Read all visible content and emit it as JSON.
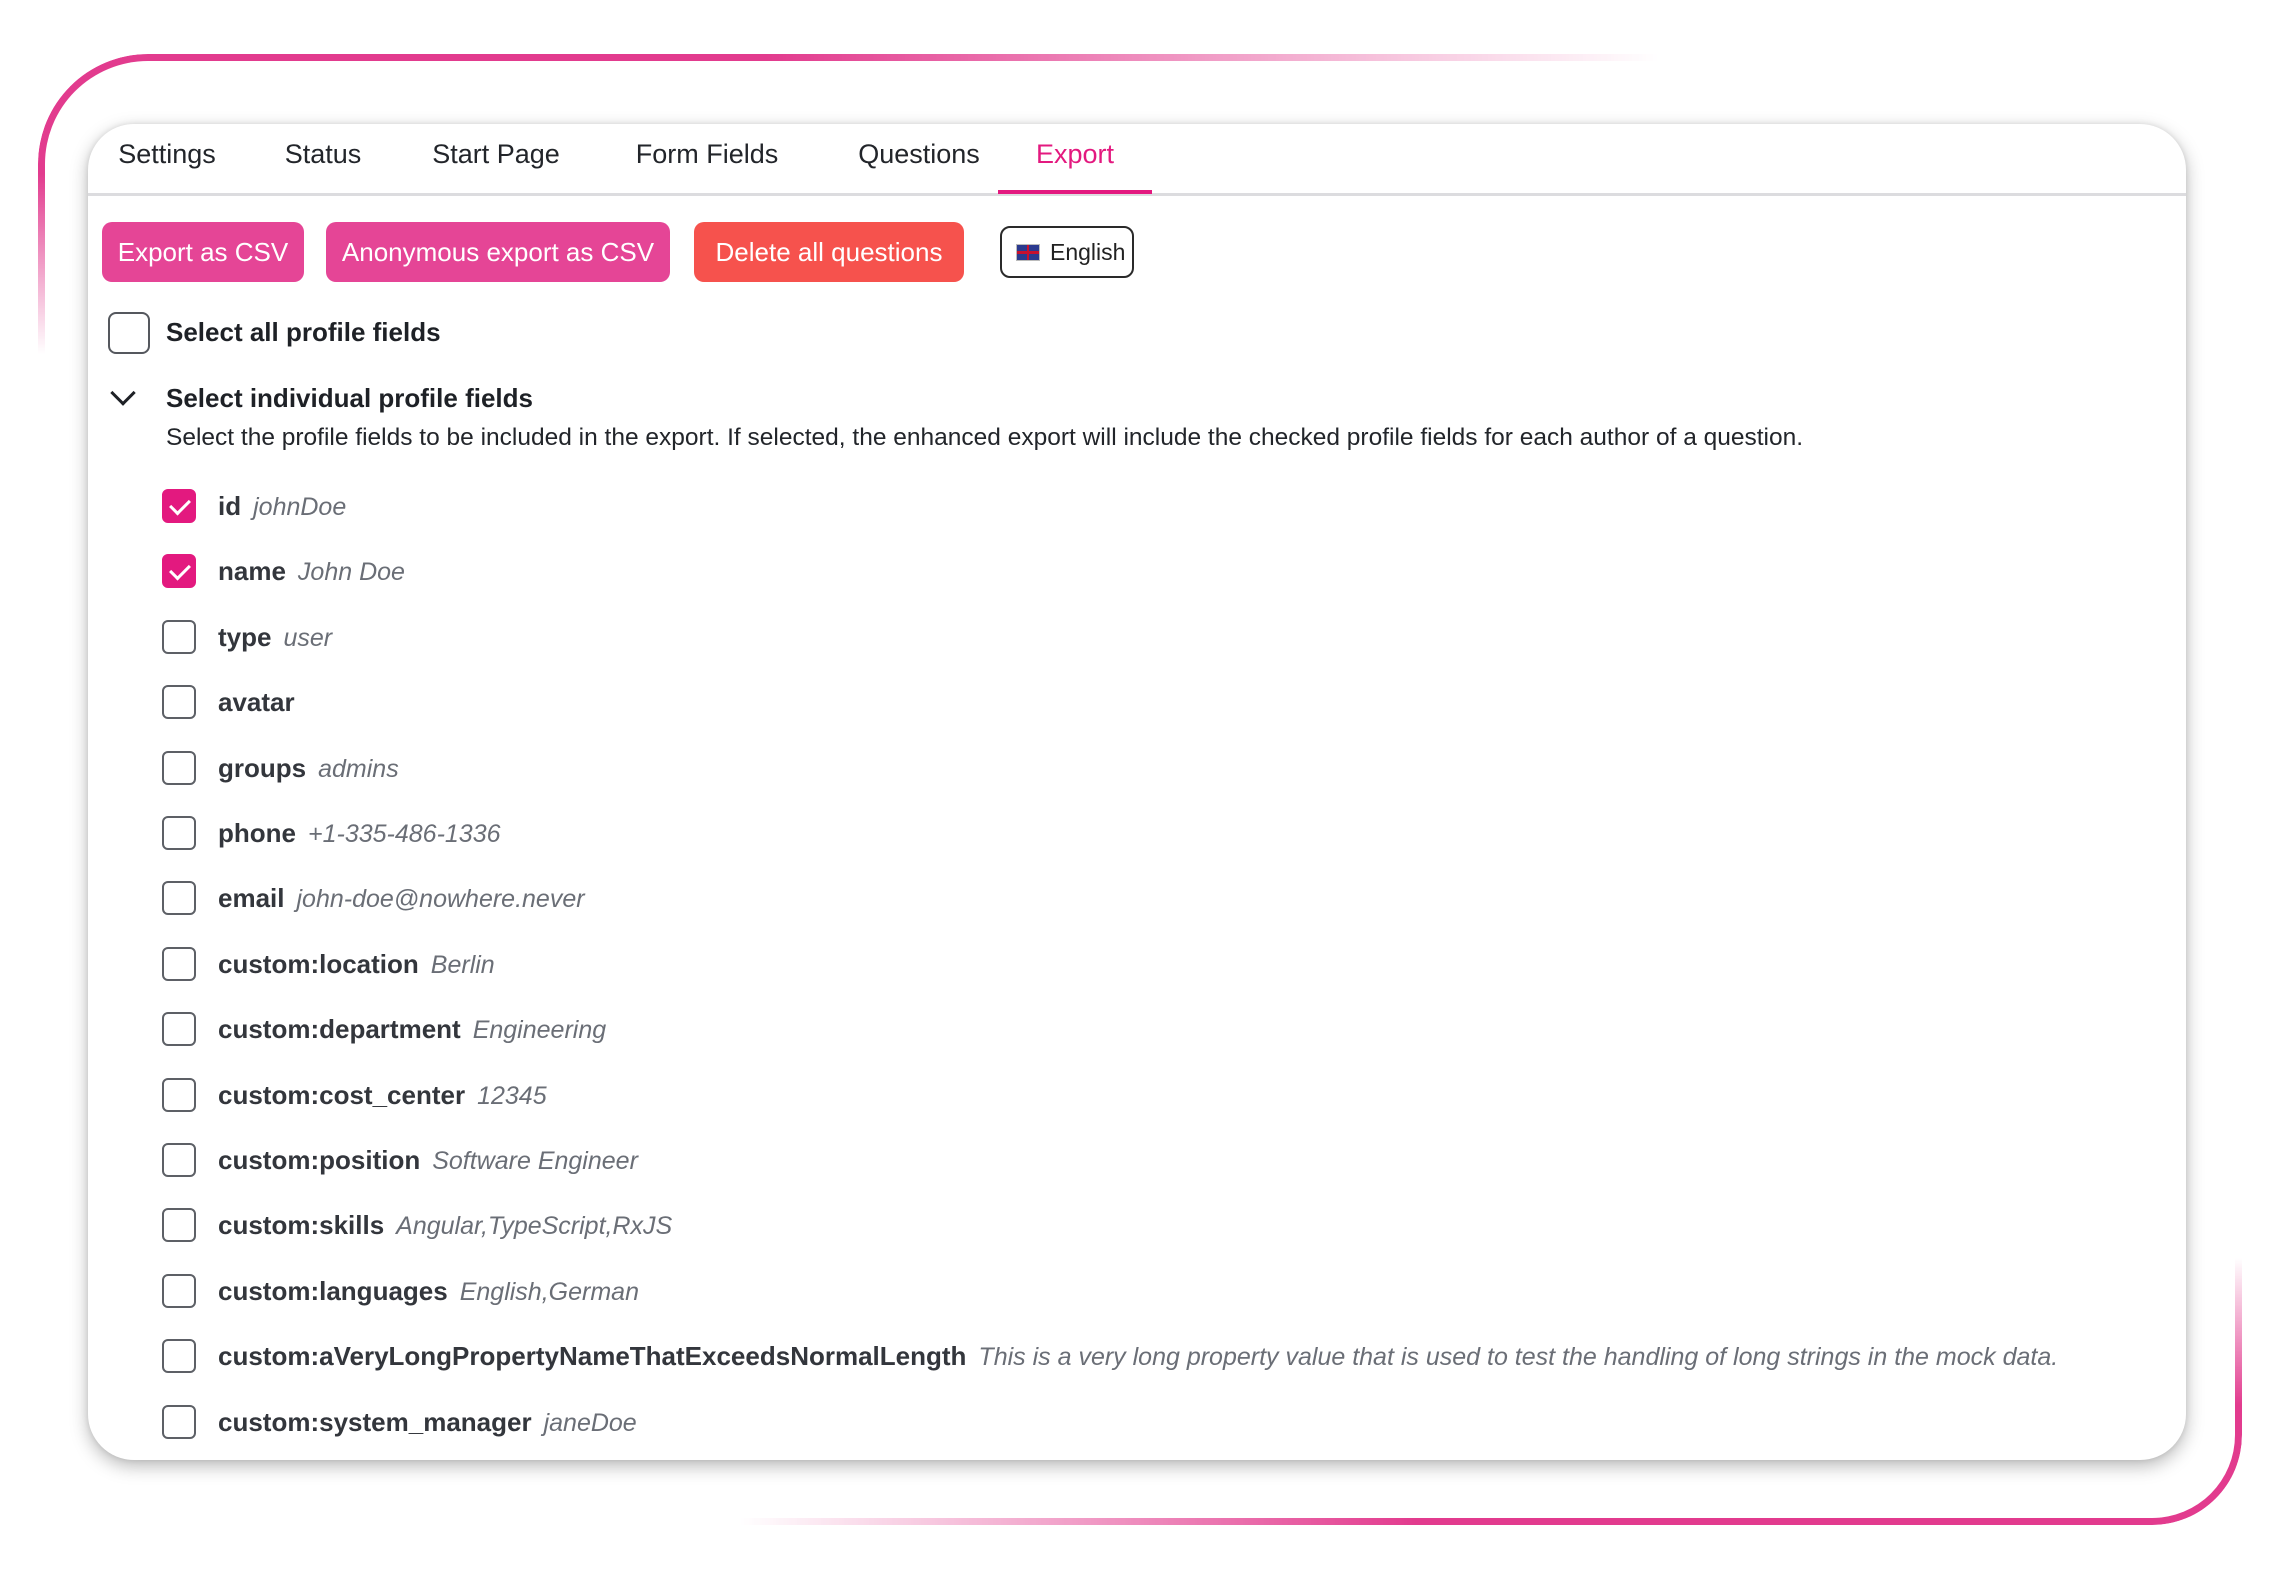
{
  "tabs": [
    {
      "label": "Settings"
    },
    {
      "label": "Status"
    },
    {
      "label": "Start Page"
    },
    {
      "label": "Form Fields"
    },
    {
      "label": "Questions"
    },
    {
      "label": "Export"
    }
  ],
  "active_tab": "Export",
  "actions": {
    "export_csv": "Export as CSV",
    "anonymous_export_csv": "Anonymous export as CSV",
    "delete_all": "Delete all questions",
    "language": "English"
  },
  "select_all_label": "Select all profile fields",
  "individual": {
    "title": "Select individual profile fields",
    "description": "Select the profile fields to be included in the export. If selected, the enhanced export will include the checked profile fields for each author of a question."
  },
  "fields": [
    {
      "name": "id",
      "value": "johnDoe",
      "checked": true
    },
    {
      "name": "name",
      "value": "John Doe",
      "checked": true
    },
    {
      "name": "type",
      "value": "user",
      "checked": false
    },
    {
      "name": "avatar",
      "value": "",
      "checked": false
    },
    {
      "name": "groups",
      "value": "admins",
      "checked": false
    },
    {
      "name": "phone",
      "value": "+1-335-486-1336",
      "checked": false
    },
    {
      "name": "email",
      "value": "john-doe@nowhere.never",
      "checked": false
    },
    {
      "name": "custom:location",
      "value": "Berlin",
      "checked": false
    },
    {
      "name": "custom:department",
      "value": "Engineering",
      "checked": false
    },
    {
      "name": "custom:cost_center",
      "value": "12345",
      "checked": false
    },
    {
      "name": "custom:position",
      "value": "Software Engineer",
      "checked": false
    },
    {
      "name": "custom:skills",
      "value": "Angular,TypeScript,RxJS",
      "checked": false
    },
    {
      "name": "custom:languages",
      "value": "English,German",
      "checked": false
    },
    {
      "name": "custom:aVeryLongPropertyNameThatExceedsNormalLength",
      "value": "This is a very long property value that is used to test the handling of long strings in the mock data.",
      "checked": false
    },
    {
      "name": "custom:system_manager",
      "value": "janeDoe",
      "checked": false
    }
  ],
  "colors": {
    "accent": "#e3197f",
    "button_pink": "#e54596",
    "button_red": "#f6524d",
    "frame": "#e23b8e"
  }
}
